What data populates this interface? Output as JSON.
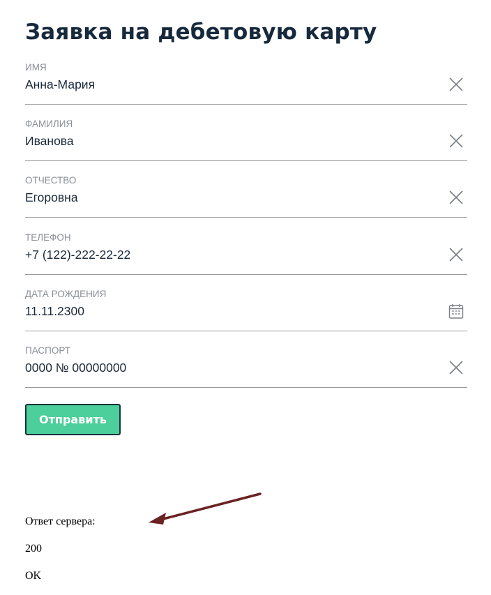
{
  "form": {
    "title": "Заявка на дебетовую карту",
    "fields": [
      {
        "label": "ИМЯ",
        "value": "Анна-Мария",
        "icon": "clear-icon"
      },
      {
        "label": "ФАМИЛИЯ",
        "value": "Иванова",
        "icon": "clear-icon"
      },
      {
        "label": "ОТЧЕСТВО",
        "value": "Егоровна",
        "icon": "clear-icon"
      },
      {
        "label": "ТЕЛЕФОН",
        "value": "+7 (122)-222-22-22",
        "icon": "clear-icon"
      },
      {
        "label": "ДАТА РОЖДЕНИЯ",
        "value": "11.11.2300",
        "icon": "calendar-icon"
      },
      {
        "label": "ПАСПОРТ",
        "value": "0000 № 00000000",
        "icon": "clear-icon"
      }
    ],
    "submit_label": "Отправить"
  },
  "response": {
    "heading": "Ответ сервера:",
    "status_code": "200",
    "status_text": "OK"
  },
  "colors": {
    "title": "#17293d",
    "label": "#8a8f96",
    "underline": "#9a9a9a",
    "button_fill": "#4ccf9a",
    "button_border": "#16343c",
    "annotation_arrow": "#6b2222"
  }
}
